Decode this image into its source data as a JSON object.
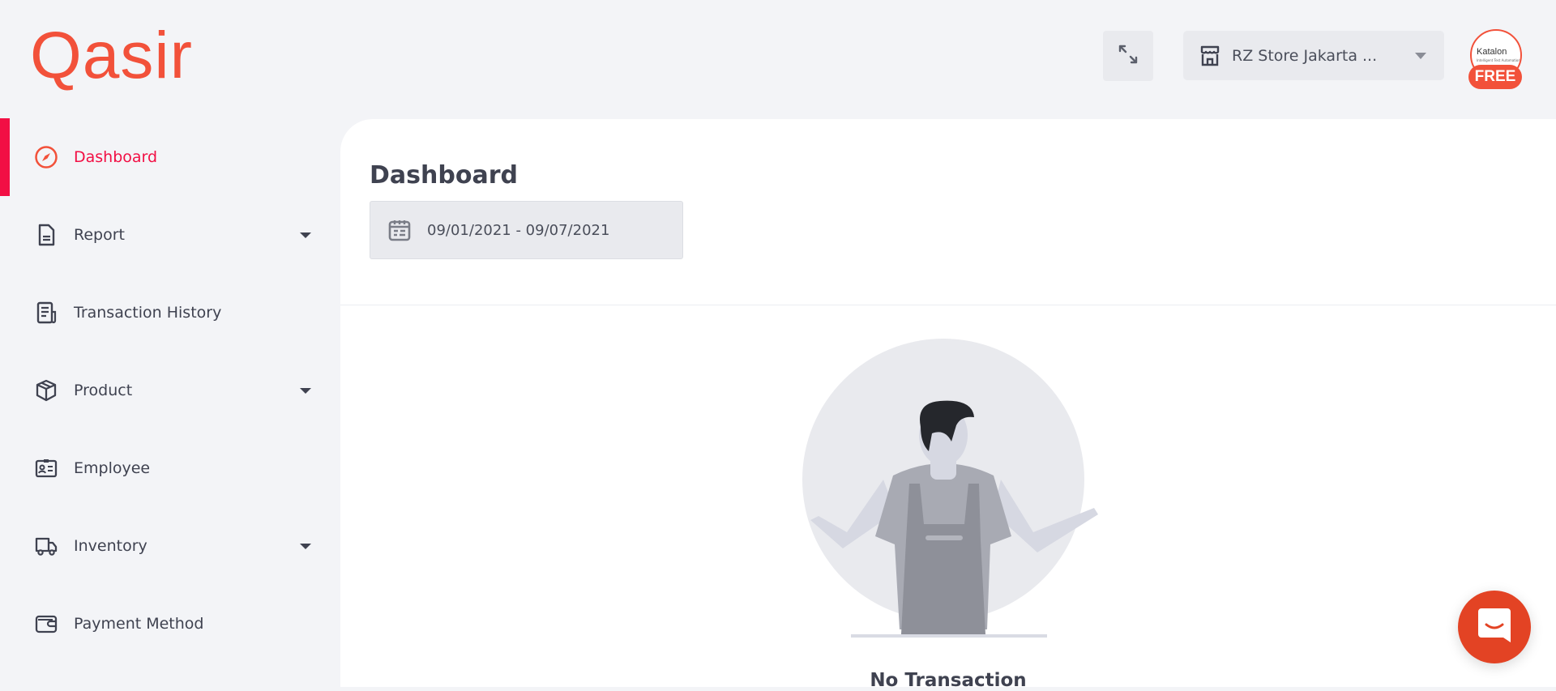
{
  "brand": {
    "logo_text": "Qasir",
    "color": "#f2513a"
  },
  "header": {
    "store_name": "RZ Store Jakarta ...",
    "avatar": {
      "brand": "Katalon",
      "tagline": "Intelligent Test Automation",
      "plan_badge": "FREE"
    }
  },
  "sidebar": {
    "active_color": "#f20f44",
    "items": [
      {
        "label": "Dashboard",
        "icon": "compass-icon",
        "active": true,
        "expandable": false
      },
      {
        "label": "Report",
        "icon": "document-icon",
        "expandable": true
      },
      {
        "label": "Transaction History",
        "icon": "receipt-icon",
        "expandable": false
      },
      {
        "label": "Product",
        "icon": "box-icon",
        "expandable": true
      },
      {
        "label": "Employee",
        "icon": "id-card-icon",
        "expandable": false
      },
      {
        "label": "Inventory",
        "icon": "truck-icon",
        "expandable": true
      },
      {
        "label": "Payment Method",
        "icon": "wallet-icon",
        "expandable": false
      }
    ]
  },
  "main": {
    "title": "Dashboard",
    "date_range": "09/01/2021 - 09/07/2021",
    "empty_state": "No Transaction"
  }
}
